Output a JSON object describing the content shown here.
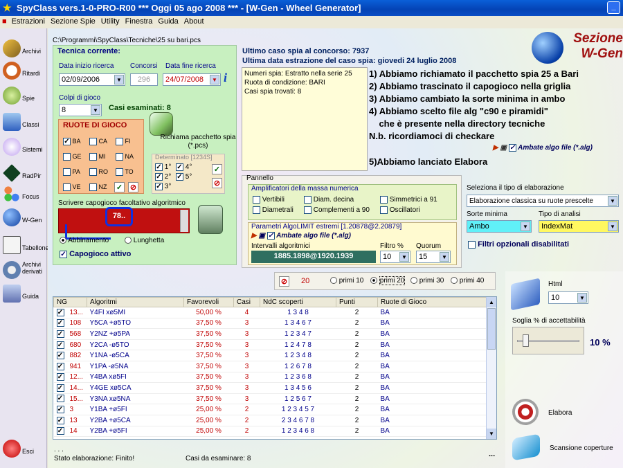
{
  "window": {
    "title": "SpyClass vers.1-0-PRO-R00  ***  Oggi 05 ago 2008  ***  - [W-Gen - Wheel Generator]",
    "minimize": "_"
  },
  "menu": [
    "Estrazioni",
    "Sezione Spie",
    "Utility",
    "Finestra",
    "Guida",
    "About"
  ],
  "sidebar": [
    {
      "label": "Archivi",
      "icon": "pencil-icon"
    },
    {
      "label": "Ritardi",
      "icon": "clock-icon"
    },
    {
      "label": "Spie",
      "icon": "spy-icon"
    },
    {
      "label": "Classi",
      "icon": "flask-icon"
    },
    {
      "label": "Sistemi",
      "icon": "bulb-icon"
    },
    {
      "label": "RadPir",
      "icon": "pyramid-icon"
    },
    {
      "label": "Focus",
      "icon": "molecule-icon"
    },
    {
      "label": "W-Gen",
      "icon": "globe-icon"
    },
    {
      "label": "Tabellone",
      "icon": "board-icon"
    },
    {
      "label": "Archivi derivati",
      "icon": "gear-icon"
    },
    {
      "label": "Guida",
      "icon": "book-icon"
    },
    {
      "label": "Esci",
      "icon": "exit-icon"
    }
  ],
  "path": "C:\\Programmi\\SpyClass\\Tecniche\\25 su bari.pcs",
  "tecnica": {
    "title": "Tecnica corrente:",
    "data_inizio_label": "Data inizio ricerca",
    "data_inizio": "02/09/2006",
    "concorsi_label": "Concorsi",
    "concorsi": "296",
    "data_fine_label": "Data fine ricerca",
    "data_fine": "24/07/2008",
    "colpi_label": "Colpi di gioco",
    "colpi": "8",
    "casi_esaminati": "Casi esaminati: 8"
  },
  "ruote": {
    "title": "RUOTE DI GIOCO",
    "items": [
      {
        "name": "BA",
        "checked": true
      },
      {
        "name": "CA",
        "checked": false
      },
      {
        "name": "FI",
        "checked": false
      },
      {
        "name": "GE",
        "checked": false
      },
      {
        "name": "MI",
        "checked": false
      },
      {
        "name": "NA",
        "checked": false
      },
      {
        "name": "PA",
        "checked": false
      },
      {
        "name": "RO",
        "checked": false
      },
      {
        "name": "TO",
        "checked": false
      },
      {
        "name": "VE",
        "checked": false
      },
      {
        "name": "NZ",
        "checked": false
      }
    ]
  },
  "richiama": "Richiama pacchetto spia (*.pcs)",
  "determinato": {
    "title": "Determinato [1234S]",
    "items": [
      {
        "name": "1°",
        "checked": true
      },
      {
        "name": "4°",
        "checked": true
      },
      {
        "name": "2°",
        "checked": true
      },
      {
        "name": "5°",
        "checked": true
      },
      {
        "name": "3°",
        "checked": true
      }
    ]
  },
  "capogioco": {
    "label": "Scrivere capogioco facoltativo algoritmico",
    "value": "78..",
    "radio1": "Abbinamento",
    "radio2": "Lunghetta",
    "attivo": "Capogioco attivo"
  },
  "header_info": {
    "ultimo": "Ultimo caso spia al concorso: 7937",
    "ultima_data": "Ultima data estrazione del caso spia:  giovedi 24 luglio 2008"
  },
  "spy_box": [
    "Numeri spia: Estratto nella serie 25",
    "Ruota di condizione: BARI",
    "Casi spia trovati: 8"
  ],
  "notes": [
    "1) Abbiamo richiamato il pacchetto spia 25 a Bari",
    "2) Abbiamo trascinato il capogioco nella griglia",
    "3) Abbiamo cambiato la sorte minima in ambo",
    "4) Abbiamo scelto file alg \"c90 e piramidi\"",
    "    che è presente nella directory tecniche",
    "N.b. ricordiamoci di checkare",
    "5)Abbiamo lanciato Elabora"
  ],
  "ambate_algo": "Ambate algo file (*.alg)",
  "sezione": {
    "line1": "Sezione",
    "line2": "W-Gen"
  },
  "pannello": {
    "title": "Pannello",
    "ampl_title": "Amplificatori della massa numerica",
    "checks": [
      "Vertibili",
      "Diam. decina",
      "Simmetrici a 91",
      "Diametrali",
      "Complementi a 90",
      "Oscillatori"
    ],
    "param_title": "Parametri AlgoLIMIT estremi [1.20878@2.20879]",
    "intervalli_label": "Intervalli algoritmici",
    "intervalli": "1885.1898@1920.1939",
    "filtro_label": "Filtro %",
    "filtro": "10",
    "quorum_label": "Quorum",
    "quorum": "15"
  },
  "elab": {
    "tipo_label": "Seleziona il tipo di elaborazione",
    "tipo": "Elaborazione classica su ruote prescelte",
    "sorte_label": "Sorte minima",
    "sorte": "Ambo",
    "analisi_label": "Tipo di analisi",
    "analisi": "IndexMat",
    "filtri": "Filtri opzionali disabilitati"
  },
  "primi": {
    "count": "20",
    "options": [
      "primi 10",
      "primi 20",
      "primi 30",
      "primi 40"
    ],
    "selected": 1
  },
  "grid": {
    "headers": [
      "NG",
      "Algoritmi",
      "Favorevoli",
      "Casi",
      "NdC scoperti",
      "Punti",
      "Ruote di Gioco"
    ],
    "rows": [
      [
        "13...",
        "Y4FI xø5MI",
        "50,00 %",
        "4",
        "1 3 4 8",
        "2",
        "BA"
      ],
      [
        "108",
        "Y5CA +ø5TO",
        "37,50 %",
        "3",
        "1 3 4 6 7",
        "2",
        "BA"
      ],
      [
        "568",
        "Y2NZ +ø5PA",
        "37,50 %",
        "3",
        "1 2 3 4 7",
        "2",
        "BA"
      ],
      [
        "680",
        "Y2CA -ø5TO",
        "37,50 %",
        "3",
        "1 2 4 7 8",
        "2",
        "BA"
      ],
      [
        "882",
        "Y1NA -ø5CA",
        "37,50 %",
        "3",
        "1 2 3 4 8",
        "2",
        "BA"
      ],
      [
        "941",
        "Y1PA -ø5NA",
        "37,50 %",
        "3",
        "1 2 6 7 8",
        "2",
        "BA"
      ],
      [
        "12...",
        "Y4BA xø5FI",
        "37,50 %",
        "3",
        "1 2 3 6 8",
        "2",
        "BA"
      ],
      [
        "14...",
        "Y4GE xø5CA",
        "37,50 %",
        "3",
        "1 3 4 5 6",
        "2",
        "BA"
      ],
      [
        "15...",
        "Y3NA xø5NA",
        "37,50 %",
        "3",
        "1 2 5 6 7",
        "2",
        "BA"
      ],
      [
        "3",
        "Y1BA +ø5FI",
        "25,00 %",
        "2",
        "1 2 3 4 5 7",
        "2",
        "BA"
      ],
      [
        "13",
        "Y2BA +ø5CA",
        "25,00 %",
        "2",
        "2 3 4 6 7 8",
        "2",
        "BA"
      ],
      [
        "14",
        "Y2BA +ø5FI",
        "25,00 %",
        "2",
        "1 2 3 4 6 8",
        "2",
        "BA"
      ]
    ]
  },
  "right": {
    "html_label": "Html",
    "html": "10",
    "soglia_label": "Soglia % di accettabilità",
    "soglia": "10 %",
    "elabora": "Elabora",
    "scansione": "Scansione coperture"
  },
  "status": {
    "dots": ". . .",
    "stato": "Stato elaborazione:  Finito!",
    "casi": "Casi da esaminare: 8",
    "more": "..."
  }
}
